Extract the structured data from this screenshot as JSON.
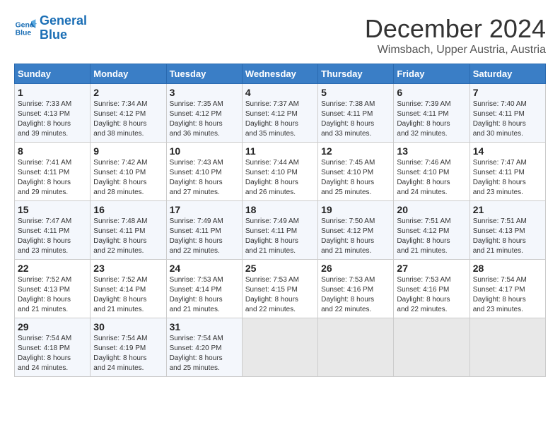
{
  "header": {
    "logo_line1": "General",
    "logo_line2": "Blue",
    "month_year": "December 2024",
    "location": "Wimsbach, Upper Austria, Austria"
  },
  "days_of_week": [
    "Sunday",
    "Monday",
    "Tuesday",
    "Wednesday",
    "Thursday",
    "Friday",
    "Saturday"
  ],
  "weeks": [
    [
      {
        "day": "1",
        "info": "Sunrise: 7:33 AM\nSunset: 4:13 PM\nDaylight: 8 hours\nand 39 minutes."
      },
      {
        "day": "2",
        "info": "Sunrise: 7:34 AM\nSunset: 4:12 PM\nDaylight: 8 hours\nand 38 minutes."
      },
      {
        "day": "3",
        "info": "Sunrise: 7:35 AM\nSunset: 4:12 PM\nDaylight: 8 hours\nand 36 minutes."
      },
      {
        "day": "4",
        "info": "Sunrise: 7:37 AM\nSunset: 4:12 PM\nDaylight: 8 hours\nand 35 minutes."
      },
      {
        "day": "5",
        "info": "Sunrise: 7:38 AM\nSunset: 4:11 PM\nDaylight: 8 hours\nand 33 minutes."
      },
      {
        "day": "6",
        "info": "Sunrise: 7:39 AM\nSunset: 4:11 PM\nDaylight: 8 hours\nand 32 minutes."
      },
      {
        "day": "7",
        "info": "Sunrise: 7:40 AM\nSunset: 4:11 PM\nDaylight: 8 hours\nand 30 minutes."
      }
    ],
    [
      {
        "day": "8",
        "info": "Sunrise: 7:41 AM\nSunset: 4:11 PM\nDaylight: 8 hours\nand 29 minutes."
      },
      {
        "day": "9",
        "info": "Sunrise: 7:42 AM\nSunset: 4:10 PM\nDaylight: 8 hours\nand 28 minutes."
      },
      {
        "day": "10",
        "info": "Sunrise: 7:43 AM\nSunset: 4:10 PM\nDaylight: 8 hours\nand 27 minutes."
      },
      {
        "day": "11",
        "info": "Sunrise: 7:44 AM\nSunset: 4:10 PM\nDaylight: 8 hours\nand 26 minutes."
      },
      {
        "day": "12",
        "info": "Sunrise: 7:45 AM\nSunset: 4:10 PM\nDaylight: 8 hours\nand 25 minutes."
      },
      {
        "day": "13",
        "info": "Sunrise: 7:46 AM\nSunset: 4:10 PM\nDaylight: 8 hours\nand 24 minutes."
      },
      {
        "day": "14",
        "info": "Sunrise: 7:47 AM\nSunset: 4:11 PM\nDaylight: 8 hours\nand 23 minutes."
      }
    ],
    [
      {
        "day": "15",
        "info": "Sunrise: 7:47 AM\nSunset: 4:11 PM\nDaylight: 8 hours\nand 23 minutes."
      },
      {
        "day": "16",
        "info": "Sunrise: 7:48 AM\nSunset: 4:11 PM\nDaylight: 8 hours\nand 22 minutes."
      },
      {
        "day": "17",
        "info": "Sunrise: 7:49 AM\nSunset: 4:11 PM\nDaylight: 8 hours\nand 22 minutes."
      },
      {
        "day": "18",
        "info": "Sunrise: 7:49 AM\nSunset: 4:11 PM\nDaylight: 8 hours\nand 21 minutes."
      },
      {
        "day": "19",
        "info": "Sunrise: 7:50 AM\nSunset: 4:12 PM\nDaylight: 8 hours\nand 21 minutes."
      },
      {
        "day": "20",
        "info": "Sunrise: 7:51 AM\nSunset: 4:12 PM\nDaylight: 8 hours\nand 21 minutes."
      },
      {
        "day": "21",
        "info": "Sunrise: 7:51 AM\nSunset: 4:13 PM\nDaylight: 8 hours\nand 21 minutes."
      }
    ],
    [
      {
        "day": "22",
        "info": "Sunrise: 7:52 AM\nSunset: 4:13 PM\nDaylight: 8 hours\nand 21 minutes."
      },
      {
        "day": "23",
        "info": "Sunrise: 7:52 AM\nSunset: 4:14 PM\nDaylight: 8 hours\nand 21 minutes."
      },
      {
        "day": "24",
        "info": "Sunrise: 7:53 AM\nSunset: 4:14 PM\nDaylight: 8 hours\nand 21 minutes."
      },
      {
        "day": "25",
        "info": "Sunrise: 7:53 AM\nSunset: 4:15 PM\nDaylight: 8 hours\nand 22 minutes."
      },
      {
        "day": "26",
        "info": "Sunrise: 7:53 AM\nSunset: 4:16 PM\nDaylight: 8 hours\nand 22 minutes."
      },
      {
        "day": "27",
        "info": "Sunrise: 7:53 AM\nSunset: 4:16 PM\nDaylight: 8 hours\nand 22 minutes."
      },
      {
        "day": "28",
        "info": "Sunrise: 7:54 AM\nSunset: 4:17 PM\nDaylight: 8 hours\nand 23 minutes."
      }
    ],
    [
      {
        "day": "29",
        "info": "Sunrise: 7:54 AM\nSunset: 4:18 PM\nDaylight: 8 hours\nand 24 minutes."
      },
      {
        "day": "30",
        "info": "Sunrise: 7:54 AM\nSunset: 4:19 PM\nDaylight: 8 hours\nand 24 minutes."
      },
      {
        "day": "31",
        "info": "Sunrise: 7:54 AM\nSunset: 4:20 PM\nDaylight: 8 hours\nand 25 minutes."
      },
      {
        "day": "",
        "info": ""
      },
      {
        "day": "",
        "info": ""
      },
      {
        "day": "",
        "info": ""
      },
      {
        "day": "",
        "info": ""
      }
    ]
  ]
}
